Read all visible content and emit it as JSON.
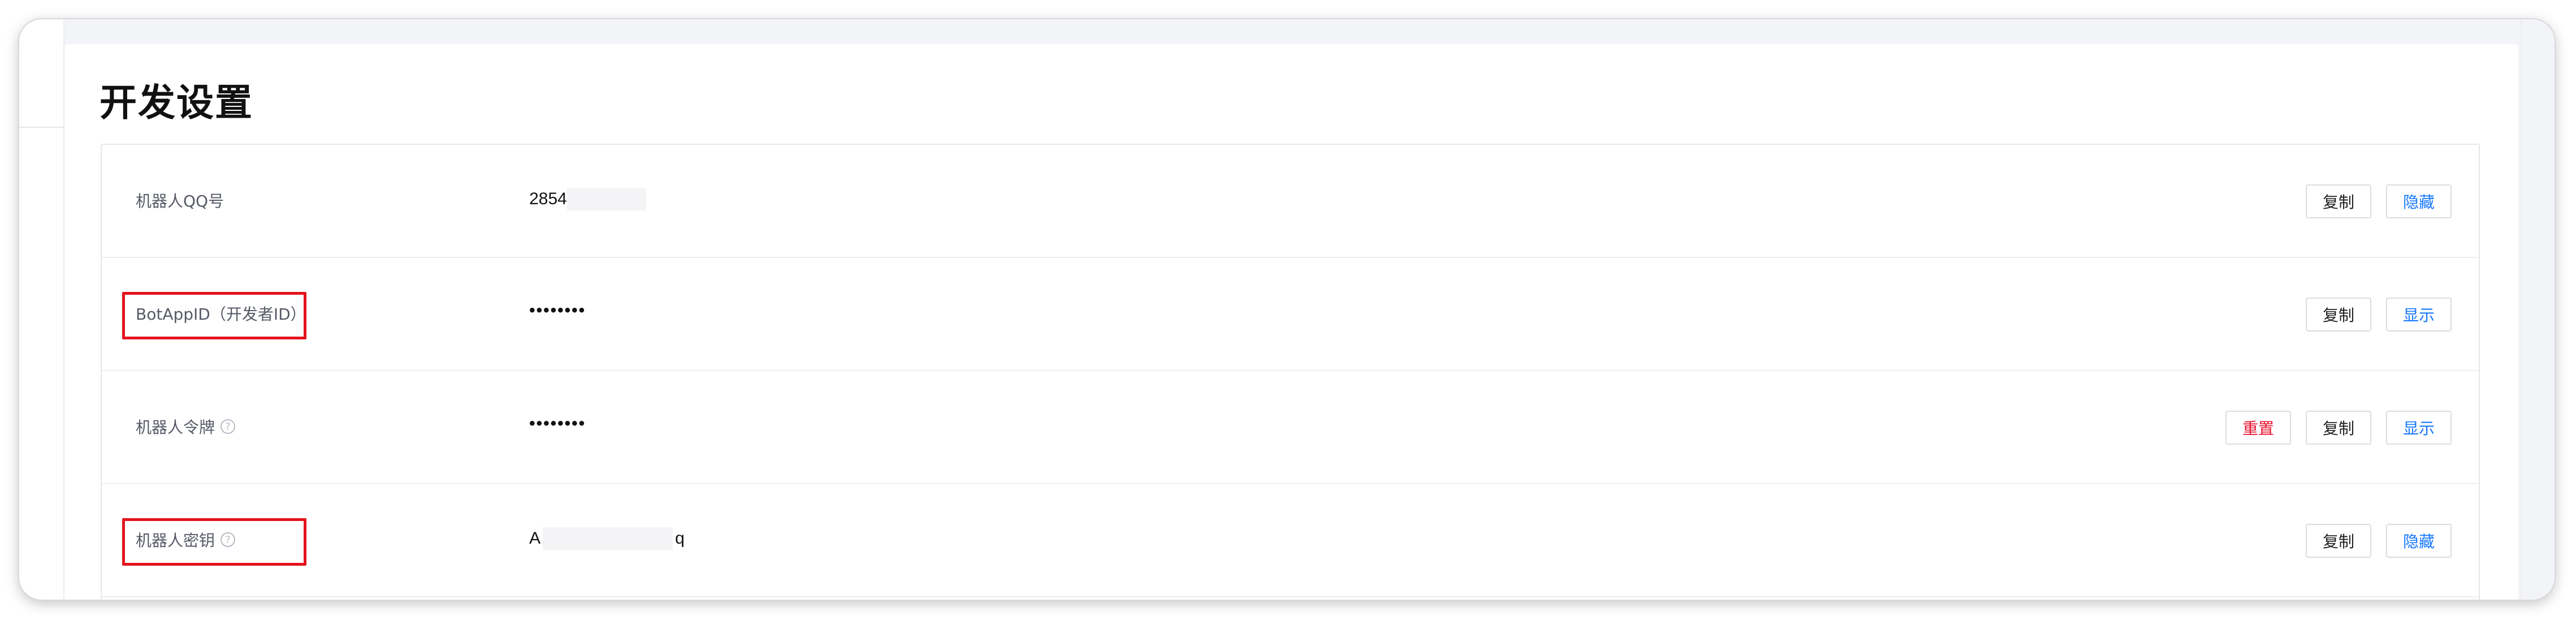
{
  "page": {
    "title": "开发设置"
  },
  "rows": [
    {
      "label": "机器人QQ号",
      "value_visible": "2854",
      "buttons": {
        "copy": "复制",
        "toggle": "隐藏"
      }
    },
    {
      "label": "BotAppID（开发者ID）",
      "value_visible": "••••••••",
      "buttons": {
        "copy": "复制",
        "toggle": "显示"
      }
    },
    {
      "label": "机器人令牌",
      "help_icon": "?",
      "value_visible": "••••••••",
      "buttons": {
        "reset": "重置",
        "copy": "复制",
        "toggle": "显示"
      }
    },
    {
      "label": "机器人密钥",
      "help_icon": "?",
      "value_start": "A",
      "value_end": "q",
      "buttons": {
        "copy": "复制",
        "toggle": "隐藏"
      }
    }
  ],
  "colors": {
    "accent_blue": "#1677ff",
    "danger_red": "#e8112d",
    "highlight_red": "#e3141d"
  }
}
